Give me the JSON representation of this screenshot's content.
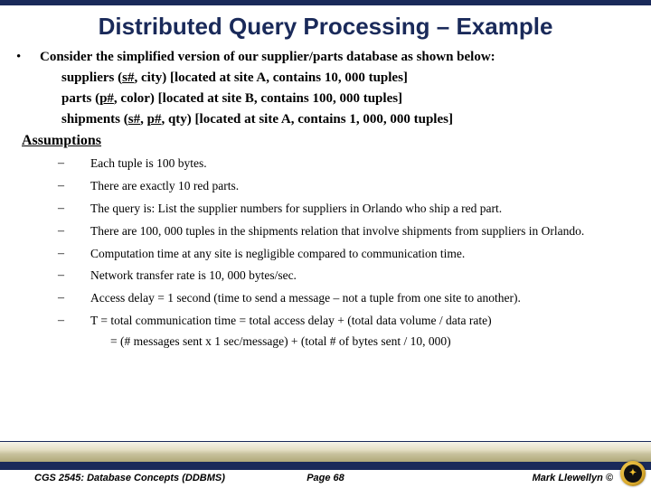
{
  "title": "Distributed Query Processing – Example",
  "bullet_char": "•",
  "intro": "Consider the simplified version of our supplier/parts database as shown below:",
  "relations": {
    "suppliers": {
      "name": "suppliers (",
      "key": "s#",
      "rest": ", city)  [located at site A, contains 10, 000 tuples]"
    },
    "parts": {
      "name": "parts (",
      "key": "p#",
      "rest": ", color)  [located at site B, contains 100, 000 tuples]"
    },
    "shipments": {
      "name": "shipments (",
      "key1": "s#",
      "mid": ", ",
      "key2": "p#",
      "rest": ", qty)  [located at site A, contains 1, 000, 000 tuples]"
    }
  },
  "assumptions_header": "Assumptions",
  "dash": "–",
  "assumptions": [
    "Each tuple is 100 bytes.",
    "There are exactly 10 red parts.",
    "The query is:  List the supplier numbers for suppliers in Orlando who ship a red part.",
    "There are 100, 000 tuples in the shipments relation that involve shipments from suppliers in Orlando.",
    "Computation time at any site is negligible compared to communication time.",
    "Network transfer rate is 10, 000 bytes/sec.",
    "Access delay = 1 second (time to send a message – not a tuple from one site to another).",
    "T = total communication time = total access delay + (total data volume / data rate)"
  ],
  "formula": "= (# messages sent  x  1 sec/message) + (total # of bytes sent / 10, 000)",
  "footer": {
    "course": "CGS 2545: Database Concepts  (DDBMS)",
    "page": "Page 68",
    "author": "Mark Llewellyn ©"
  },
  "logo_label": "ucf-pegasus-logo"
}
